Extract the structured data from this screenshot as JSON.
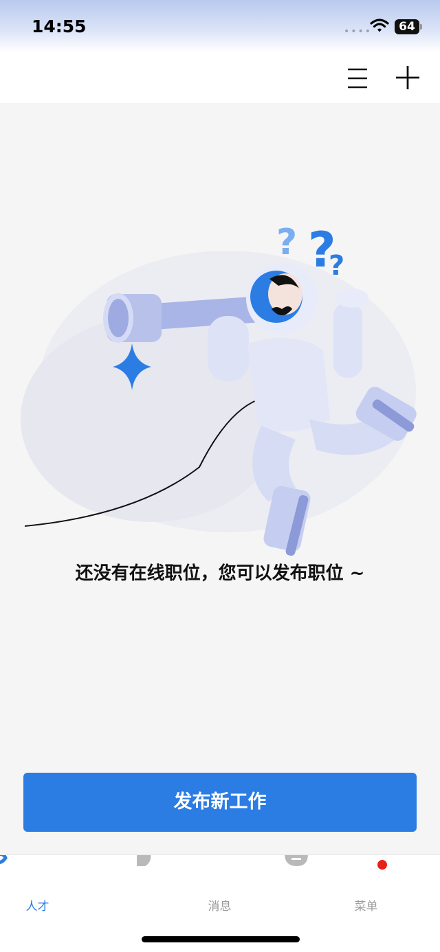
{
  "status_bar": {
    "time": "14:55",
    "battery": "64",
    "signal_icon": "signal-dots-icon",
    "wifi_icon": "wifi-icon"
  },
  "header": {
    "menu_icon": "menu-icon",
    "add_icon": "plus-icon"
  },
  "empty_state": {
    "illustration": "astronaut-telescope-illustration",
    "message": "还没有在线职位，您可以发布职位 ~"
  },
  "actions": {
    "publish_label": "发布新工作"
  },
  "tabbar": {
    "tabs": [
      {
        "label": "人才",
        "active": true,
        "icon": "talent-icon"
      },
      {
        "label": "消息",
        "active": false,
        "icon": "message-icon"
      },
      {
        "label": "菜单",
        "active": false,
        "icon": "menu-tab-icon",
        "badge": "red-dot"
      }
    ]
  },
  "colors": {
    "primary": "#2b7de3",
    "background": "#f5f5f5",
    "badge_red": "#e8201c"
  }
}
